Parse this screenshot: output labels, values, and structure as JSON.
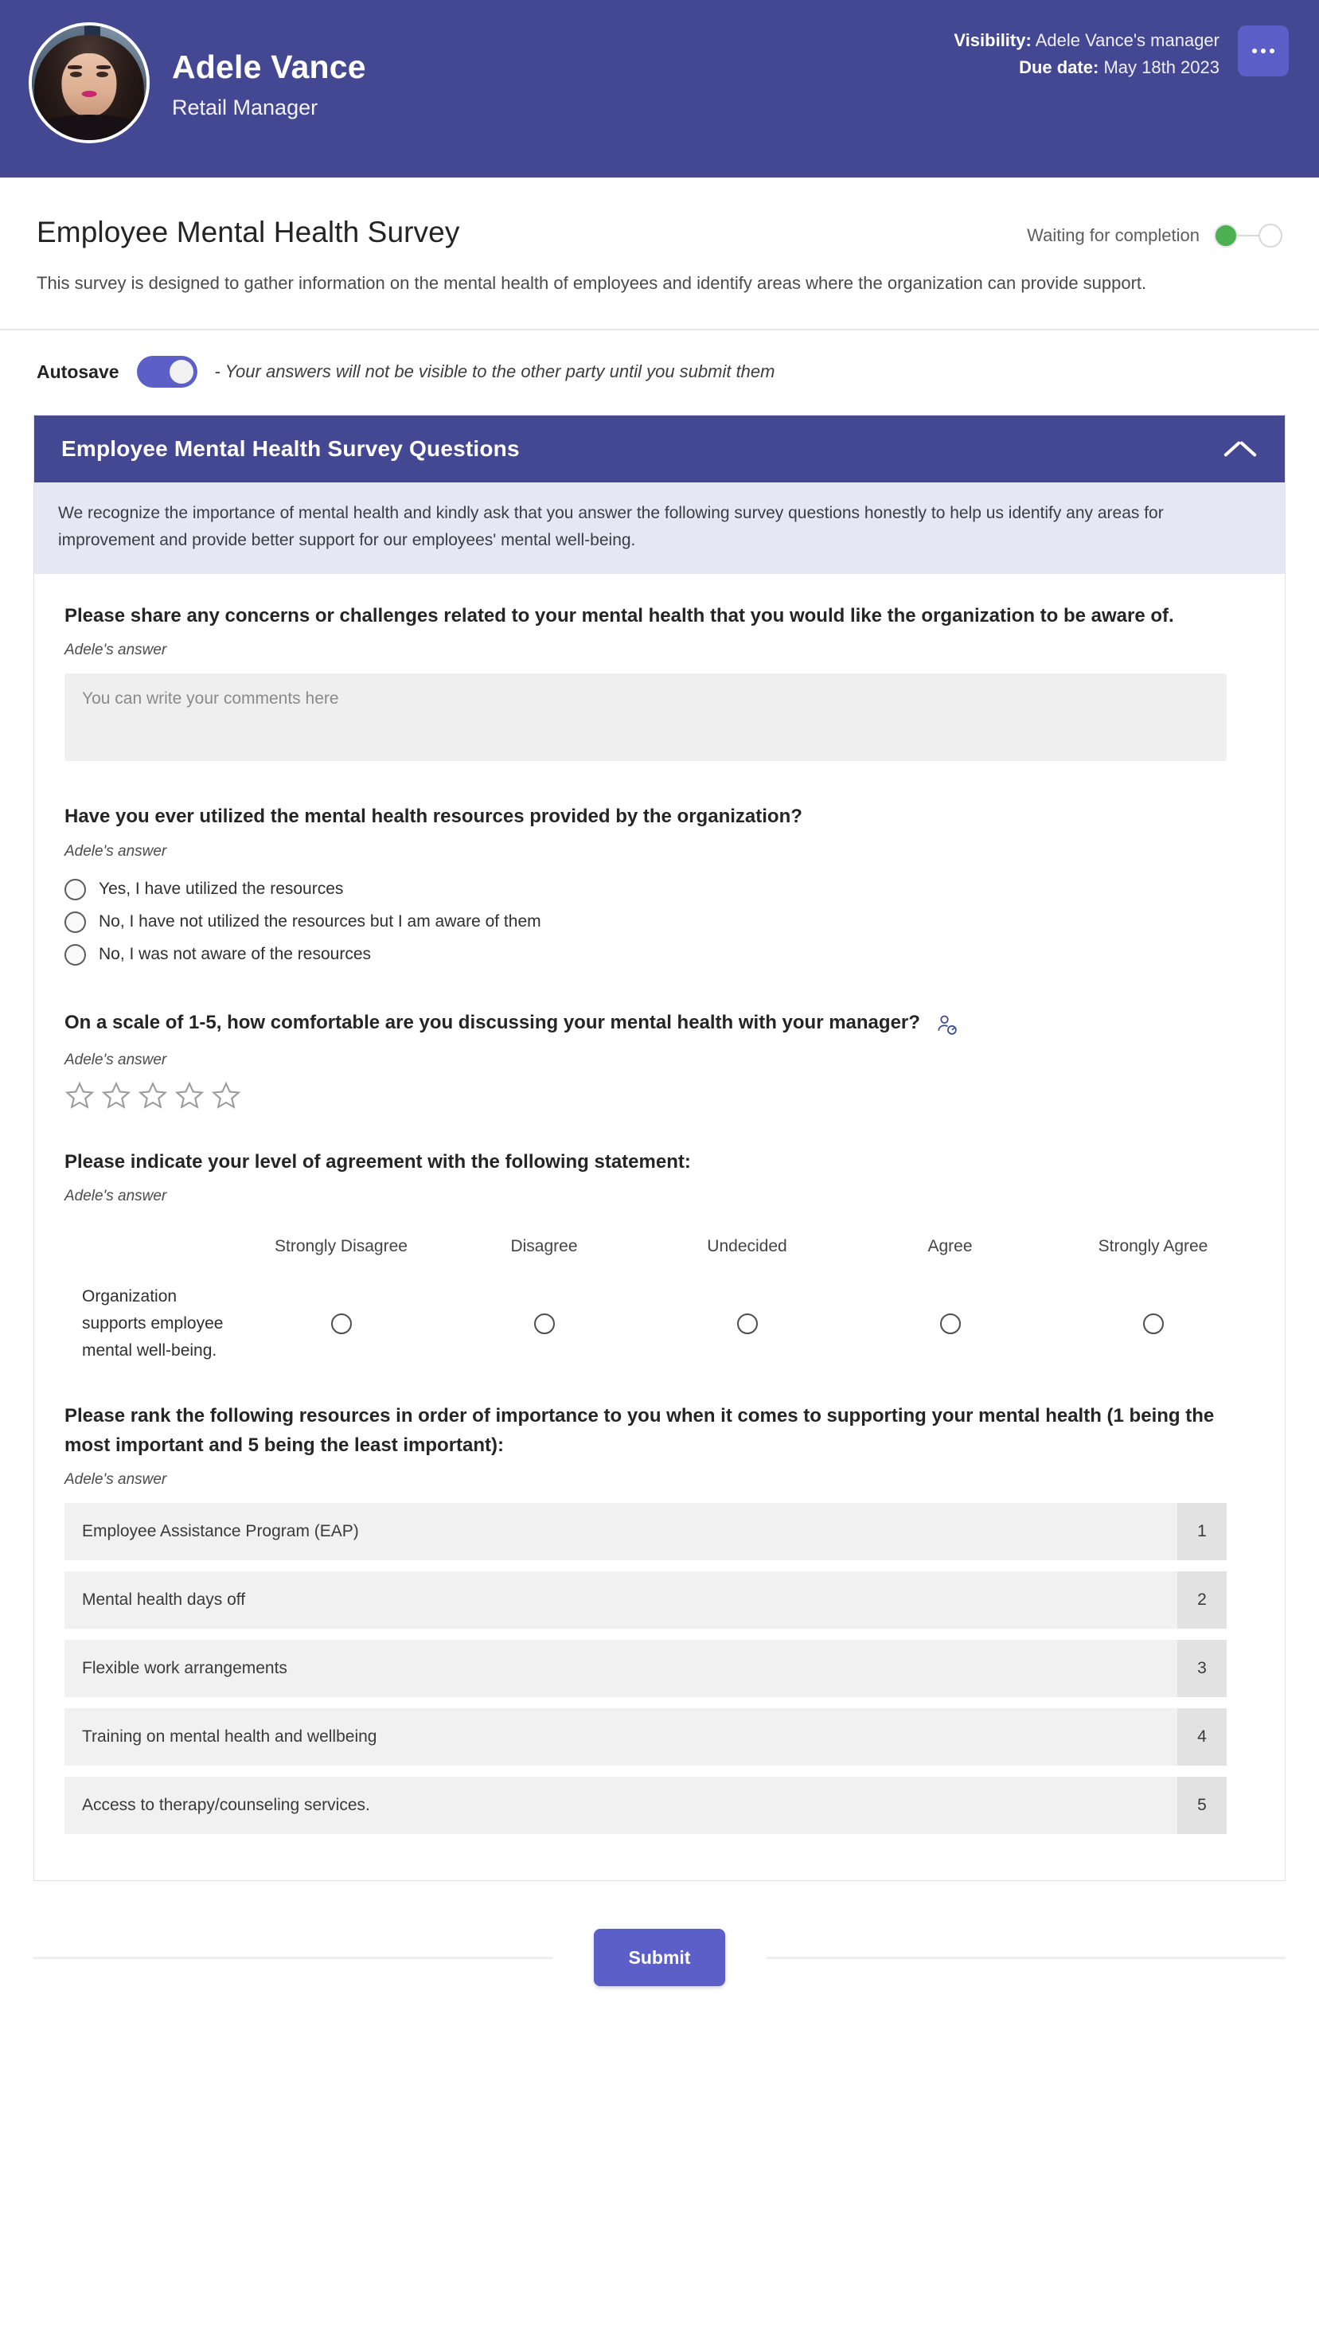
{
  "banner": {
    "user_name": "Adele Vance",
    "user_role": "Retail Manager",
    "visibility_key": "Visibility:",
    "visibility_value": "Adele Vance's manager",
    "due_date_key": "Due date:",
    "due_date_value": "May 18th 2023",
    "more_icon": "ellipsis-icon",
    "avatar_icon": "avatar",
    "accent_color": "#444791",
    "button_color": "#5b5fc7"
  },
  "header": {
    "title": "Employee Mental Health Survey",
    "description": "This survey is designed to gather information on the mental health of employees and identify areas where the organization can provide support.",
    "status_text": "Waiting for completion",
    "status_color": "#4caf50"
  },
  "autosave": {
    "label": "Autosave",
    "state": "on",
    "note": "- Your answers will not be visible to the other party until you submit them"
  },
  "card": {
    "title": "Employee Mental Health Survey Questions",
    "collapse_icon": "chevron-up-icon",
    "note": "We recognize the importance of mental health and kindly ask that you answer the following survey questions honestly to help us identify any areas for improvement and provide better support for our employees' mental well-being.",
    "answer_label": "Adele's answer"
  },
  "questions": {
    "q1": {
      "text": "Please share any concerns or challenges related to your mental health that you would like the organization to be aware of.",
      "answer_label": "Adele's answer",
      "placeholder": "You can write your comments here",
      "value": ""
    },
    "q2": {
      "text": "Have you ever utilized the mental health resources provided by the organization?",
      "answer_label": "Adele's answer",
      "options": [
        "Yes, I have utilized the resources",
        "No, I have not utilized the resources but I am aware of them",
        "No, I was not aware of the resources"
      ]
    },
    "q3": {
      "text": "On a scale of 1-5, how comfortable are you discussing your mental health with your manager?",
      "answer_label": "Adele's answer",
      "icon": "person-badge-icon",
      "max_stars": 5,
      "rating": 0
    },
    "q4": {
      "text": "Please indicate your level of agreement with the following statement:",
      "answer_label": "Adele's answer",
      "columns": [
        "Strongly Disagree",
        "Disagree",
        "Undecided",
        "Agree",
        "Strongly Agree"
      ],
      "statement": "Organization supports employee mental well-being.",
      "selected": null
    },
    "q5": {
      "text": "Please rank the following resources in order of importance to you when it comes to supporting your mental health (1 being the most important and 5 being the least important):",
      "answer_label": "Adele's answer",
      "items": [
        {
          "label": "Employee Assistance Program (EAP)",
          "rank": "1"
        },
        {
          "label": "Mental health days off",
          "rank": "2"
        },
        {
          "label": "Flexible work arrangements",
          "rank": "3"
        },
        {
          "label": "Training on mental health and wellbeing",
          "rank": "4"
        },
        {
          "label": "Access to therapy/counseling services.",
          "rank": "5"
        }
      ]
    }
  },
  "footer": {
    "submit_label": "Submit"
  }
}
